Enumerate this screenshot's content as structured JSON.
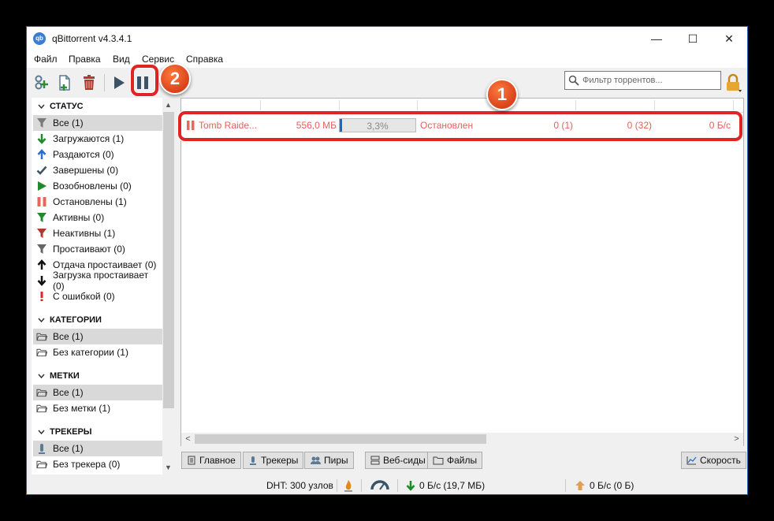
{
  "window": {
    "title": "qBittorrent v4.3.4.1",
    "icon_label": "qb",
    "controls": {
      "minimize": "—",
      "maximize": "☐",
      "close": "✕"
    }
  },
  "menu": [
    "Файл",
    "Правка",
    "Вид",
    "Сервис",
    "Справка"
  ],
  "toolbar": {
    "buttons": [
      "add-link",
      "add-file",
      "delete",
      "resume",
      "pause"
    ],
    "filter_placeholder": "Фильтр торрентов..."
  },
  "sidebar": {
    "status_title": "СТАТУС",
    "status_items": [
      {
        "label": "Все (1)",
        "icon": "funnel-gray",
        "selected": true
      },
      {
        "label": "Загружаются (1)",
        "icon": "arrow-down-green"
      },
      {
        "label": "Раздаются (0)",
        "icon": "arrow-up-blue"
      },
      {
        "label": "Завершены (0)",
        "icon": "checkmark"
      },
      {
        "label": "Возобновлены (0)",
        "icon": "play-green"
      },
      {
        "label": "Остановлены (1)",
        "icon": "pause-red"
      },
      {
        "label": "Активны (0)",
        "icon": "funnel-green"
      },
      {
        "label": "Неактивны (1)",
        "icon": "funnel-red"
      },
      {
        "label": "Простаивают (0)",
        "icon": "funnel-gray"
      },
      {
        "label": "Отдача простаивает (0)",
        "icon": "arrow-up-black"
      },
      {
        "label": "Загрузка простаивает (0)",
        "icon": "arrow-down-black"
      },
      {
        "label": "С ошибкой (0)",
        "icon": "exclamation-red"
      }
    ],
    "categories_title": "КАТЕГОРИИ",
    "categories": [
      {
        "label": "Все (1)",
        "selected": true
      },
      {
        "label": "Без категории (1)"
      }
    ],
    "tags_title": "МЕТКИ",
    "tags": [
      {
        "label": "Все (1)",
        "selected": true
      },
      {
        "label": "Без метки (1)"
      }
    ],
    "trackers_title": "ТРЕКЕРЫ",
    "trackers": [
      {
        "label": "Все (1)",
        "selected": true
      },
      {
        "label": "Без трекера (0)"
      }
    ]
  },
  "torrent": {
    "name": "Tomb Raide...",
    "size": "556,0 МБ",
    "progress_text": "3,3%",
    "progress": 0.033,
    "status": "Остановлен",
    "seeds": "0 (1)",
    "peers": "0 (32)",
    "speed": "0 Б/с"
  },
  "tabs": [
    "Главное",
    "Трекеры",
    "Пиры",
    "Веб-сиды",
    "Файлы"
  ],
  "speed_button": "Скорость",
  "statusbar": {
    "dht": "DHT: 300 узлов",
    "download": "0 Б/с (19,7 МБ)",
    "upload": "0 Б/с (0 Б)"
  },
  "annotations": {
    "badge1": "1",
    "badge2": "2"
  },
  "colors": {
    "highlight": "#e02424",
    "badge": "#e5512a",
    "stopped_text": "#e8605a",
    "progress": "#0b6fc7"
  }
}
